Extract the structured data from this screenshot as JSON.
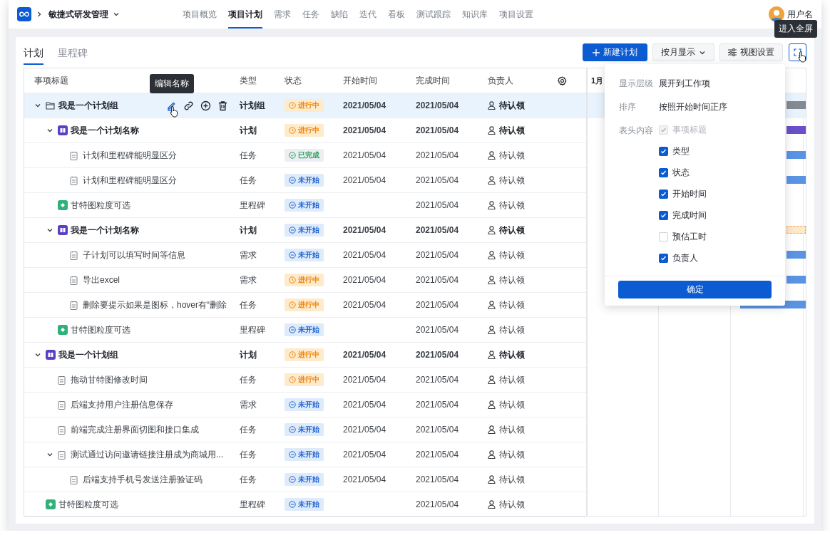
{
  "app": {
    "name": "敏捷式研发管理"
  },
  "nav": [
    {
      "label": "项目概览",
      "selected": false
    },
    {
      "label": "项目计划",
      "selected": true
    },
    {
      "label": "需求",
      "selected": false
    },
    {
      "label": "任务",
      "selected": false
    },
    {
      "label": "缺陷",
      "selected": false
    },
    {
      "label": "迭代",
      "selected": false
    },
    {
      "label": "看板",
      "selected": false
    },
    {
      "label": "测试跟踪",
      "selected": false
    },
    {
      "label": "知识库",
      "selected": false
    },
    {
      "label": "项目设置",
      "selected": false
    }
  ],
  "user": {
    "name": "用户名"
  },
  "subtabs": [
    {
      "label": "计划",
      "selected": true
    },
    {
      "label": "里程碑",
      "selected": false
    }
  ],
  "toolbar": {
    "new_button": "新建计划",
    "view_mode": "按月显示",
    "view_settings": "视图设置",
    "fullscreen_tooltip": "进入全屏"
  },
  "table": {
    "columns": [
      "事项标题",
      "类型",
      "状态",
      "开始时间",
      "完成时间",
      "负责人"
    ],
    "action_tooltip": "编辑名称",
    "rows": [
      {
        "kind": "group",
        "title": "我是一个计划组",
        "type": "计划组",
        "status": {
          "kind": "in_progress",
          "text": "进行中"
        },
        "start": "2021/05/04",
        "end": "2021/05/04",
        "owner": "待认领",
        "expanded": true,
        "selected": true,
        "bar": {
          "kind": "group"
        },
        "children": [
          {
            "kind": "plan",
            "title": "我是一个计划名称",
            "type": "计划",
            "status": {
              "kind": "in_progress",
              "text": "进行中"
            },
            "start": "2021/05/04",
            "end": "2021/05/04",
            "owner": "待认领",
            "expanded": true,
            "selected": false,
            "bar": {
              "kind": "plan"
            },
            "children": [
              {
                "kind": "task",
                "title": "计划和里程碑能明显区分",
                "type": "任务",
                "status": {
                  "kind": "done",
                  "text": "已完成"
                },
                "start": "2021/05/04",
                "end": "2021/05/04",
                "owner": "待认领",
                "selected": false,
                "bar": {
                  "kind": "task"
                }
              },
              {
                "kind": "task",
                "title": "计划和里程碑能明显区分",
                "type": "任务",
                "status": {
                  "kind": "not_started",
                  "text": "未开始"
                },
                "start": "2021/05/04",
                "end": "2021/05/04",
                "owner": "待认领",
                "selected": false,
                "bar": {
                  "kind": "task"
                }
              }
            ]
          },
          {
            "kind": "milestone",
            "title": "甘特图粒度可选",
            "type": "里程碑",
            "status": {
              "kind": "not_started",
              "text": "未开始"
            },
            "end": "2021/05/04",
            "owner": "待认领",
            "selected": false
          },
          {
            "kind": "plan",
            "title": "我是一个计划名称",
            "type": "计划",
            "status": {
              "kind": "not_started",
              "text": "未开始"
            },
            "start": "2021/05/04",
            "end": "2021/05/04",
            "owner": "待认领",
            "expanded": true,
            "selected": false,
            "bar": {
              "kind": "pending"
            },
            "children": [
              {
                "kind": "task",
                "title": "子计划可以填写时间等信息",
                "type": "需求",
                "status": {
                  "kind": "not_started",
                  "text": "未开始"
                },
                "start": "2021/05/04",
                "end": "2021/05/04",
                "owner": "待认领",
                "selected": false,
                "bar": {
                  "kind": "task"
                }
              },
              {
                "kind": "task",
                "title": "导出excel",
                "type": "需求",
                "status": {
                  "kind": "in_progress",
                  "text": "进行中"
                },
                "start": "2021/05/04",
                "end": "2021/05/04",
                "owner": "待认领",
                "selected": false,
                "bar": {
                  "kind": "task"
                }
              },
              {
                "kind": "task",
                "title": "删除要提示如果是图标，hover有“删除",
                "type": "任务",
                "status": {
                  "kind": "in_progress",
                  "text": "进行中"
                },
                "start": "2021/05/04",
                "end": "2021/05/04",
                "owner": "待认领",
                "selected": false,
                "bar": {
                  "kind": "long"
                }
              }
            ]
          },
          {
            "kind": "milestone",
            "title": "甘特图粒度可选",
            "type": "里程碑",
            "status": {
              "kind": "not_started",
              "text": "未开始"
            },
            "end": "2021/05/04",
            "owner": "待认领",
            "selected": false
          }
        ]
      },
      {
        "kind": "plan",
        "title": "我是一个计划组",
        "type": "计划",
        "status": {
          "kind": "in_progress",
          "text": "进行中"
        },
        "start": "2021/05/04",
        "end": "2021/05/04",
        "owner": "待认领",
        "expanded": true,
        "selected": false,
        "children": [
          {
            "kind": "task",
            "title": "拖动甘特图修改时间",
            "type": "任务",
            "status": {
              "kind": "in_progress",
              "text": "进行中"
            },
            "start": "2021/05/04",
            "end": "2021/05/04",
            "owner": "待认领",
            "selected": false
          },
          {
            "kind": "task",
            "title": "后端支持用户注册信息保存",
            "type": "需求",
            "status": {
              "kind": "not_started",
              "text": "未开始"
            },
            "start": "2021/05/04",
            "end": "2021/05/04",
            "owner": "待认领",
            "selected": false
          },
          {
            "kind": "task",
            "title": "前端完成注册界面切图和接口集成",
            "type": "任务",
            "status": {
              "kind": "not_started",
              "text": "未开始"
            },
            "start": "2021/05/04",
            "end": "2021/05/04",
            "owner": "待认领",
            "selected": false
          },
          {
            "kind": "task",
            "title": "测试通过访问邀请链接注册成为商城用...",
            "type": "任务",
            "status": {
              "kind": "not_started",
              "text": "未开始"
            },
            "start": "2021/05/04",
            "end": "2021/05/04",
            "owner": "待认领",
            "expanded": true,
            "selected": false,
            "children": [
              {
                "kind": "task",
                "title": "后端支持手机号发送注册验证码",
                "type": "任务",
                "status": {
                  "kind": "not_started",
                  "text": "未开始"
                },
                "start": "2021/05/04",
                "end": "2021/05/04",
                "owner": "待认领",
                "selected": false
              }
            ]
          }
        ]
      },
      {
        "kind": "milestone",
        "title": "甘特图粒度可选",
        "type": "里程碑",
        "status": {
          "kind": "not_started",
          "text": "未开始"
        },
        "end": "2021/05/04",
        "owner": "待认领",
        "selected": false
      }
    ]
  },
  "gantt": {
    "header": "1月"
  },
  "view_popup": {
    "fields": [
      {
        "label": "显示层级",
        "value": "展开到工作项"
      },
      {
        "label": "排序",
        "value": "按照开始时间正序"
      }
    ],
    "columns_label": "表头内容",
    "column_options": [
      {
        "label": "事项标题",
        "checked": true,
        "disabled": true
      },
      {
        "label": "类型",
        "checked": true,
        "disabled": false
      },
      {
        "label": "状态",
        "checked": true,
        "disabled": false
      },
      {
        "label": "开始时间",
        "checked": true,
        "disabled": false
      },
      {
        "label": "完成时间",
        "checked": true,
        "disabled": false
      },
      {
        "label": "预估工时",
        "checked": false,
        "disabled": false
      },
      {
        "label": "负责人",
        "checked": true,
        "disabled": false
      }
    ],
    "confirm": "确定"
  }
}
